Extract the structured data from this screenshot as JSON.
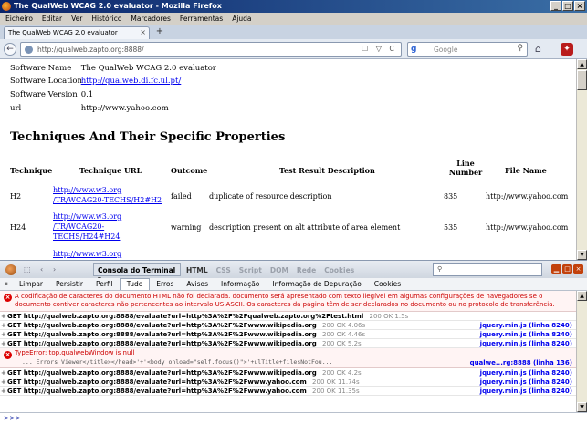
{
  "window": {
    "title": "The QualWeb WCAG 2.0 evaluator - Mozilla Firefox",
    "controls": [
      "_",
      "□",
      "×"
    ]
  },
  "menu": [
    "Eicheiro",
    "Editar",
    "Ver",
    "Histórico",
    "Marcadores",
    "Ferramentas",
    "Ajuda"
  ],
  "tab": {
    "label": "The QualWeb WCAG 2.0 evaluator",
    "close": "×",
    "new": "+"
  },
  "nav": {
    "url": "http://qualweb.zapto.org:8888/",
    "url_tools": "☐ ▽ C",
    "search_placeholder": "Google",
    "back": "←",
    "home": "⌂"
  },
  "page": {
    "info": [
      {
        "key": "Software Name",
        "value": "The QualWeb WCAG 2.0 evaluator",
        "link": false
      },
      {
        "key": "Software Location",
        "value": "http://qualweb.di.fc.ul.pt/",
        "link": true
      },
      {
        "key": "Software Version",
        "value": "0.1",
        "link": false
      },
      {
        "key": "url",
        "value": "http://www.yahoo.com",
        "link": false
      }
    ],
    "heading": "Techniques And Their Specific Properties",
    "table": {
      "headers": [
        "Technique",
        "Technique URL",
        "Outcome",
        "Test Result Description",
        "Line Number",
        "File Name"
      ],
      "line_header_1": "Line",
      "line_header_2": "Number",
      "rows": [
        {
          "technique": "H2",
          "url_1": "http://www.w3.org",
          "url_2": "/TR/WCAG20-TECHS/H2#H2",
          "url_3": "",
          "outcome": "failed",
          "description": "duplicate of resource description",
          "line": "835",
          "file": "http://www.yahoo.com"
        },
        {
          "technique": "H24",
          "url_1": "http://www.w3.org",
          "url_2": "/TR/WCAG20-",
          "url_3": "TECHS/H24#H24",
          "outcome": "warning",
          "description": "description present on alt attribute of area element",
          "line": "535",
          "file": "http://www.yahoo.com"
        },
        {
          "technique": "",
          "url_1": "http://www.w3.org",
          "url_2": "",
          "url_3": "",
          "outcome": "",
          "description": "",
          "line": "",
          "file": ""
        }
      ]
    }
  },
  "firebug": {
    "panel_select": "Consola do Terminal ▾",
    "tabs": [
      "HTML",
      "CSS",
      "Script",
      "DOM",
      "Rede",
      "Cookies"
    ],
    "sub_tabs": [
      "Limpar",
      "Persistir",
      "Perfil",
      "Tudo",
      "Erros",
      "Avisos",
      "Informação",
      "Informação de Depuração",
      "Cookies"
    ],
    "active_sub_tab": "Tudo",
    "console": {
      "encoding_error": "A codificação de caracteres do documento HTML não foi declarada. documento será apresentado com texto ilegível em algumas configurações de navegadores se o documento contiver caracteres não pertencentes ao intervalo US-ASCII. Os caracteres da página têm de ser declarados no documento ou no protocolo de transferência.",
      "requests_a": [
        {
          "url": "GET http://qualweb.zapto.org:8888/evaluate?url=http%3A%2F%2Fqualweb.zapto.org%2Ftest.html",
          "status": "200 OK 1.5s",
          "src": ""
        },
        {
          "url": "GET http://qualweb.zapto.org:8888/evaluate?url=http%3A%2F%2Fwww.wikipedia.org",
          "status": "200 OK 4.06s",
          "src": "jquery.min.js (linha 8240)"
        },
        {
          "url": "GET http://qualweb.zapto.org:8888/evaluate?url=http%3A%2F%2Fwww.wikipedia.org",
          "status": "200 OK 4.46s",
          "src": "jquery.min.js (linha 8240)"
        },
        {
          "url": "GET http://qualweb.zapto.org:8888/evaluate?url=http%3A%2F%2Fwww.wikipedia.org",
          "status": "200 OK 5.2s",
          "src": "jquery.min.js (linha 8240)"
        }
      ],
      "type_error": "TypeError: top.qualwebWindow is null",
      "type_error_code": "... Errors Viewer</title></head>'+'<body onload=\"self.focus()\">'+ulTitle+filesNotFou...",
      "type_error_src": "qualwe...rg:8888 (linha 136)",
      "requests_b": [
        {
          "url": "GET http://qualweb.zapto.org:8888/evaluate?url=http%3A%2F%2Fwww.wikipedia.org",
          "status": "200 OK 4.2s",
          "src": "jquery.min.js (linha 8240)"
        },
        {
          "url": "GET http://qualweb.zapto.org:8888/evaluate?url=http%3A%2F%2Fwww.yahoo.com",
          "status": "200 OK 11.74s",
          "src": "jquery.min.js (linha 8240)"
        },
        {
          "url": "GET http://qualweb.zapto.org:8888/evaluate?url=http%3A%2F%2Fwww.yahoo.com",
          "status": "200 OK 11.35s",
          "src": "jquery.min.js (linha 8240)"
        }
      ]
    },
    "prompt": ">>>"
  }
}
